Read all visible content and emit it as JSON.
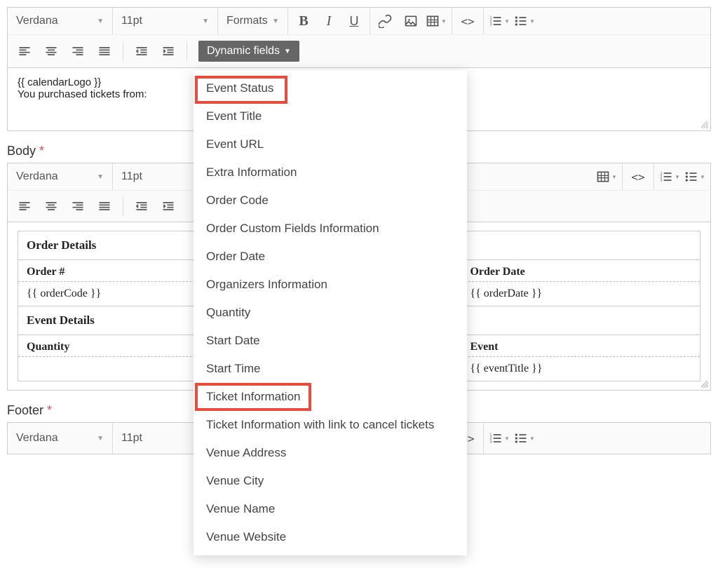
{
  "toolbars": {
    "font": "Verdana",
    "size": "11pt",
    "formats": "Formats",
    "dynamicFieldsLabel": "Dynamic fields"
  },
  "editor1": {
    "line1": "{{ calendarLogo }}",
    "line2": "You purchased tickets from:"
  },
  "labels": {
    "body": "Body",
    "footer": "Footer"
  },
  "bodyTable": {
    "orderDetails": "Order Details",
    "orderNum": "Order #",
    "orderDate": "Order Date",
    "orderCodeVal": "{{ orderCode }}",
    "orderDateVal": "{{ orderDate }}",
    "eventDetails": "Event Details",
    "quantity": "Quantity",
    "event": "Event",
    "eventTitleVal": "{{ eventTitle }}"
  },
  "dropdown": {
    "items": [
      "Event Status",
      "Event Title",
      "Event URL",
      "Extra Information",
      "Order Code",
      "Order Custom Fields Information",
      "Order Date",
      "Organizers Information",
      "Quantity",
      "Start Date",
      "Start Time",
      "Ticket Information",
      "Ticket Information with link to cancel tickets",
      "Venue Address",
      "Venue City",
      "Venue Name",
      "Venue Website"
    ]
  }
}
